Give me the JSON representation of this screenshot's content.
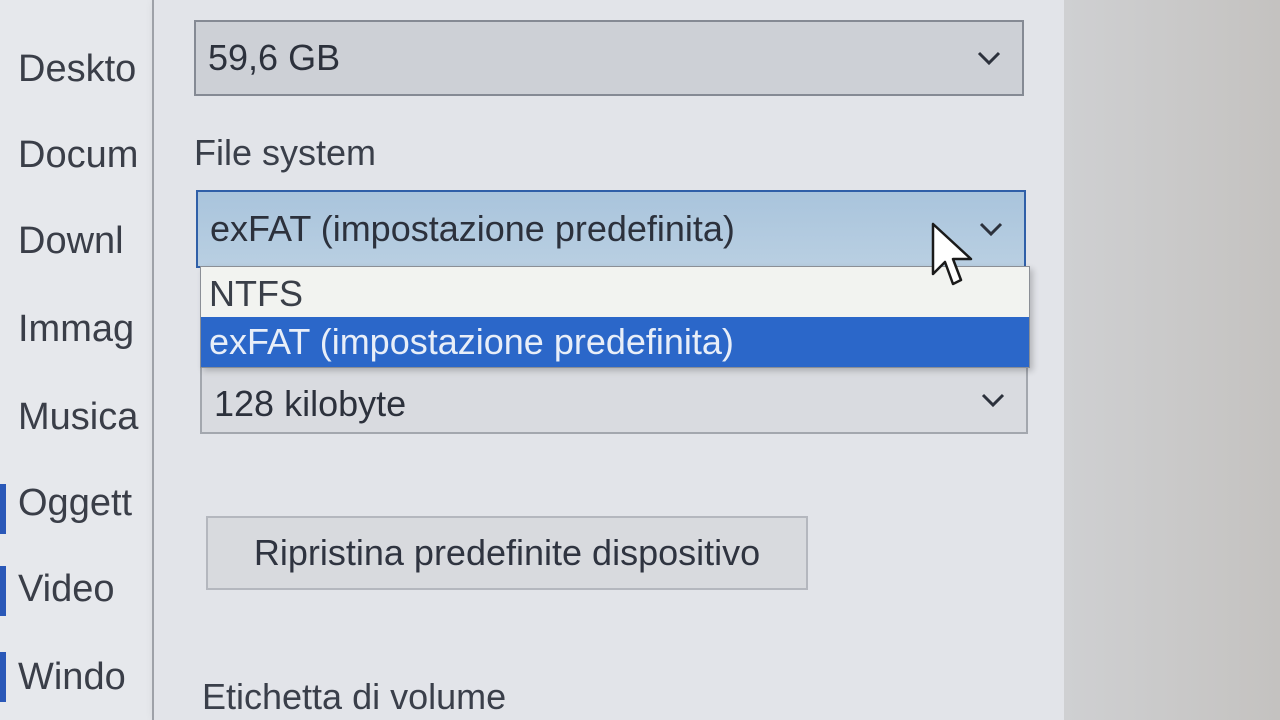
{
  "nav_pane": {
    "items": [
      {
        "label": "Deskto"
      },
      {
        "label": "Docum"
      },
      {
        "label": "Downl"
      },
      {
        "label": "Immag"
      },
      {
        "label": "Musica"
      },
      {
        "label": "Oggett"
      },
      {
        "label": "Video"
      },
      {
        "label": "Windo"
      }
    ]
  },
  "dialog": {
    "capacity": {
      "value": "59,6 GB"
    },
    "file_system": {
      "label": "File system",
      "value": "exFAT (impostazione predefinita)",
      "options": [
        {
          "label": "NTFS",
          "selected": false
        },
        {
          "label": "exFAT (impostazione predefinita)",
          "selected": true
        }
      ]
    },
    "allocation_unit": {
      "value": "128 kilobyte"
    },
    "restore_button": {
      "label": "Ripristina predefinite dispositivo"
    },
    "volume_label": {
      "label": "Etichetta di volume"
    }
  },
  "colors": {
    "selection": "#2b67c9",
    "focus_border": "#2f5fa8",
    "combo_bg": "#cdd0d6"
  },
  "icons": {
    "dropdown_chevron": "chevron-down-icon",
    "pointer": "mouse-cursor-icon"
  }
}
